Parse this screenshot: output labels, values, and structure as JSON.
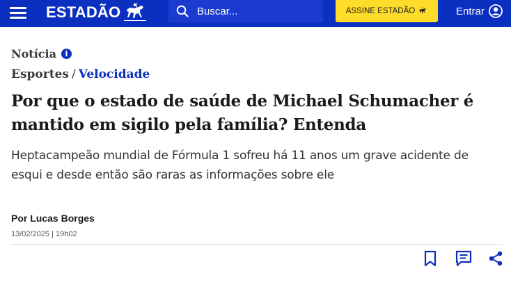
{
  "header": {
    "logo_text": "ESTADÃO",
    "search_placeholder": "Buscar...",
    "subscribe_label": "ASSINE ESTADÃO",
    "login_label": "Entrar"
  },
  "article": {
    "kicker": "Notícia",
    "breadcrumb": {
      "section": "Esportes",
      "separator": "/",
      "subsection": "Velocidade"
    },
    "headline": "Por que o estado de saúde de Michael Schumacher é mantido em sigilo pela família? Entenda",
    "subtitle": "Heptacampeão mundial de Fórmula 1 sofreu há 11 anos um grave acidente de esqui e desde então são raras as informações sobre ele",
    "author": "Por Lucas Borges",
    "date": "13/02/2025 | 19h02"
  },
  "icons": {
    "menu": "hamburger-menu-icon",
    "logo_mark": "horse-rider-icon",
    "search": "search-icon",
    "user": "user-circle-icon",
    "info": "info-icon",
    "bookmark": "bookmark-icon",
    "comments": "comment-icon",
    "share": "share-icon"
  },
  "colors": {
    "brand_blue": "#0b2fbf",
    "search_bg": "#1a3ad0",
    "subscribe_yellow": "#ffdc29",
    "text_dark": "#1b1b1b"
  }
}
